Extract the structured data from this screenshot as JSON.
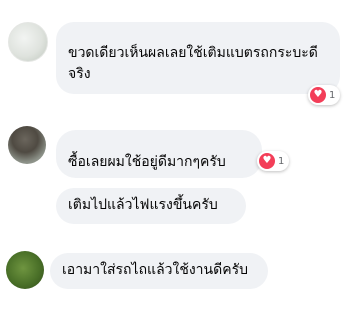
{
  "comments": [
    {
      "text": "ขวดเดียวเห็นผลเลยใช้เติมแบตรถกระบะดีจริง",
      "reaction_count": "1",
      "reaction_icon": "heart-icon"
    },
    {
      "text": "ซื้อเลยผมใช้อยู่ดีมากๆครับ",
      "reaction_count": "1",
      "reaction_icon": "heart-icon"
    },
    {
      "text": "เติมไปแล้วไฟแรงขึ้นครับ"
    },
    {
      "text": "เอามาใส่รถไถแล้วใช้งานดีครับ"
    }
  ],
  "colors": {
    "bubble": "#f0f2f5",
    "heart": "#f33e58"
  }
}
